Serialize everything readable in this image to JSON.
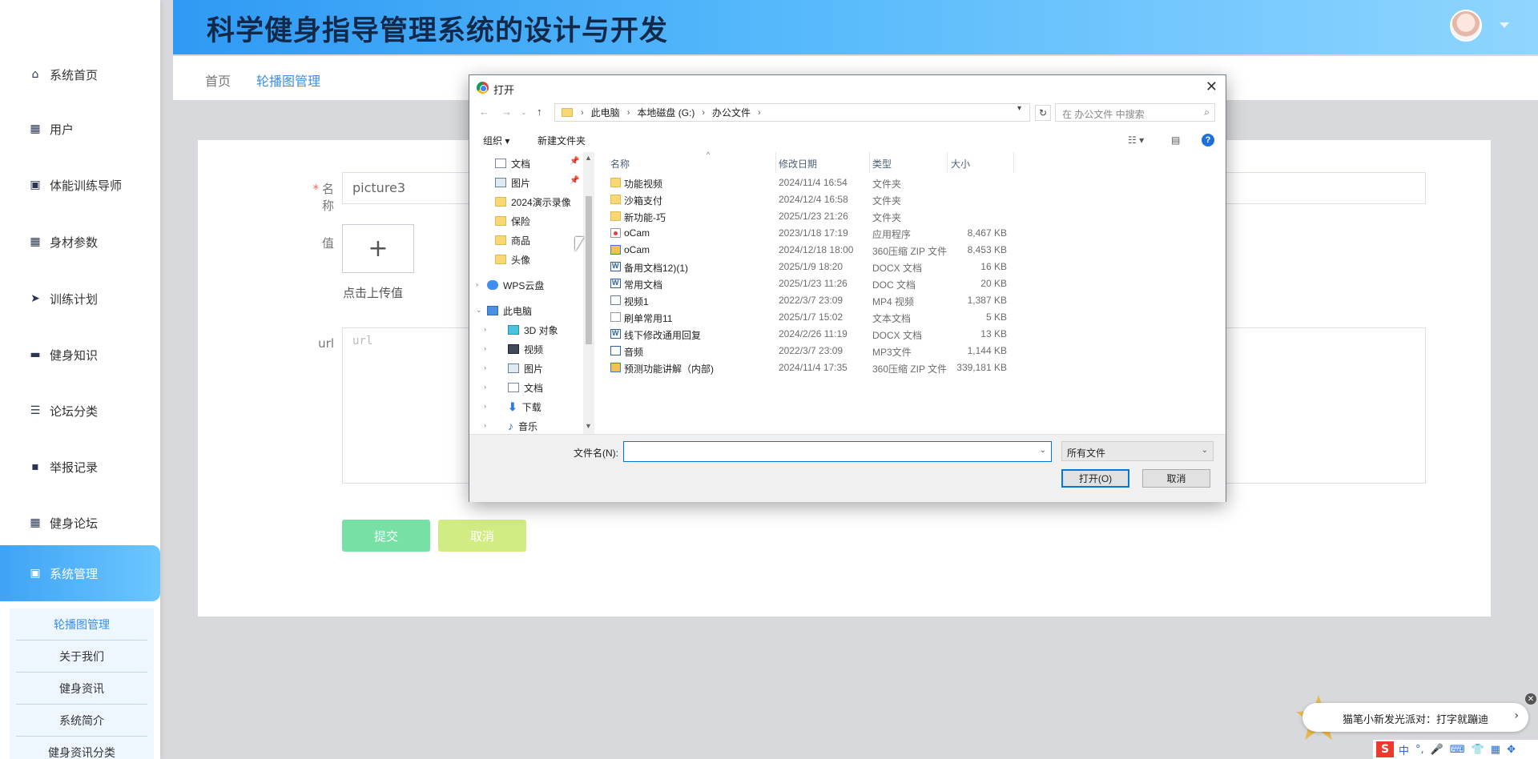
{
  "header": {
    "title": "科学健身指导管理系统的设计与开发"
  },
  "sidebar": {
    "items": [
      {
        "label": "系统首页",
        "icon": "home-icon"
      },
      {
        "label": "用户",
        "icon": "grid-icon"
      },
      {
        "label": "体能训练导师",
        "icon": "clipboard-icon"
      },
      {
        "label": "身材参数",
        "icon": "grid-icon"
      },
      {
        "label": "训练计划",
        "icon": "send-icon"
      },
      {
        "label": "健身知识",
        "icon": "monitor-icon"
      },
      {
        "label": "论坛分类",
        "icon": "sliders-icon"
      },
      {
        "label": "举报记录",
        "icon": "chat-icon"
      },
      {
        "label": "健身论坛",
        "icon": "grid-icon"
      },
      {
        "label": "系统管理",
        "icon": "clipboard-icon"
      }
    ],
    "submenu": [
      "轮播图管理",
      "关于我们",
      "健身资讯",
      "系统简介",
      "健身资讯分类"
    ]
  },
  "breadcrumb": {
    "home": "首页",
    "current": "轮播图管理"
  },
  "form": {
    "name_label": "名称",
    "name_required_mark": "*",
    "name_value": "picture3",
    "value_label": "值",
    "upload_plus": "+",
    "upload_tip": "点击上传值",
    "url_label": "url",
    "url_placeholder": "url",
    "submit_label": "提交",
    "cancel_label": "取消"
  },
  "dialog": {
    "title": "打开",
    "address": [
      "此电脑",
      "本地磁盘 (G:)",
      "办公文件"
    ],
    "search_placeholder": "在 办公文件 中搜索",
    "organize_label": "组织 ▾",
    "new_folder_label": "新建文件夹",
    "columns": {
      "name": "名称",
      "date": "修改日期",
      "type": "类型",
      "size": "大小"
    },
    "tree": [
      {
        "label": "文档",
        "icon": "doc",
        "pinned": true
      },
      {
        "label": "图片",
        "icon": "pic",
        "pinned": true
      },
      {
        "label": "2024演示录像",
        "icon": "fold"
      },
      {
        "label": "保险",
        "icon": "fold"
      },
      {
        "label": "商品",
        "icon": "fold"
      },
      {
        "label": "头像",
        "icon": "fold"
      },
      {
        "label": "WPS云盘",
        "icon": "cloud"
      },
      {
        "label": "此电脑",
        "icon": "pc"
      },
      {
        "label": "3D 对象",
        "icon": "cube"
      },
      {
        "label": "视频",
        "icon": "film"
      },
      {
        "label": "图片",
        "icon": "pic"
      },
      {
        "label": "文档",
        "icon": "doc"
      },
      {
        "label": "下载",
        "icon": "download"
      },
      {
        "label": "音乐",
        "icon": "music"
      }
    ],
    "files": [
      {
        "name": "功能视频",
        "date": "2024/11/4 16:54",
        "type": "文件夹",
        "size": "",
        "icon": "folder"
      },
      {
        "name": "沙箱支付",
        "date": "2024/12/4 16:58",
        "type": "文件夹",
        "size": "",
        "icon": "folder"
      },
      {
        "name": "新功能-巧",
        "date": "2025/1/23 21:26",
        "type": "文件夹",
        "size": "",
        "icon": "folder"
      },
      {
        "name": "oCam",
        "date": "2023/1/18 17:19",
        "type": "应用程序",
        "size": "8,467 KB",
        "icon": "exe"
      },
      {
        "name": "oCam",
        "date": "2024/12/18 18:00",
        "type": "360压缩 ZIP 文件",
        "size": "8,453 KB",
        "icon": "zip"
      },
      {
        "name": "备用文档12)(1)",
        "date": "2025/1/9 18:20",
        "type": "DOCX 文档",
        "size": "16 KB",
        "icon": "docx"
      },
      {
        "name": "常用文档",
        "date": "2025/1/23 11:26",
        "type": "DOC 文档",
        "size": "20 KB",
        "icon": "docx"
      },
      {
        "name": "视频1",
        "date": "2022/3/7 23:09",
        "type": "MP4 视频",
        "size": "1,387 KB",
        "icon": "mp4"
      },
      {
        "name": "刷单常用11",
        "date": "2025/1/7 15:02",
        "type": "文本文档",
        "size": "5 KB",
        "icon": "txt"
      },
      {
        "name": "线下修改通用回复",
        "date": "2024/2/26 11:19",
        "type": "DOCX 文档",
        "size": "13 KB",
        "icon": "docx"
      },
      {
        "name": "音频",
        "date": "2022/3/7 23:09",
        "type": "MP3文件",
        "size": "1,144 KB",
        "icon": "mp3"
      },
      {
        "name": "预测功能讲解（内部)",
        "date": "2024/11/4 17:35",
        "type": "360压缩 ZIP 文件",
        "size": "339,181 KB",
        "icon": "zip"
      }
    ],
    "filename_label": "文件名(N):",
    "filename_value": "",
    "filetype_value": "所有文件",
    "open_label": "打开(O)",
    "cancel_label": "取消"
  },
  "ime": {
    "banner_text": "猫笔小新发光派对：打字就蹦迪",
    "bar_items": [
      "中",
      "°,",
      "🎤",
      "⌨",
      "👕",
      "▦",
      "✥"
    ]
  }
}
